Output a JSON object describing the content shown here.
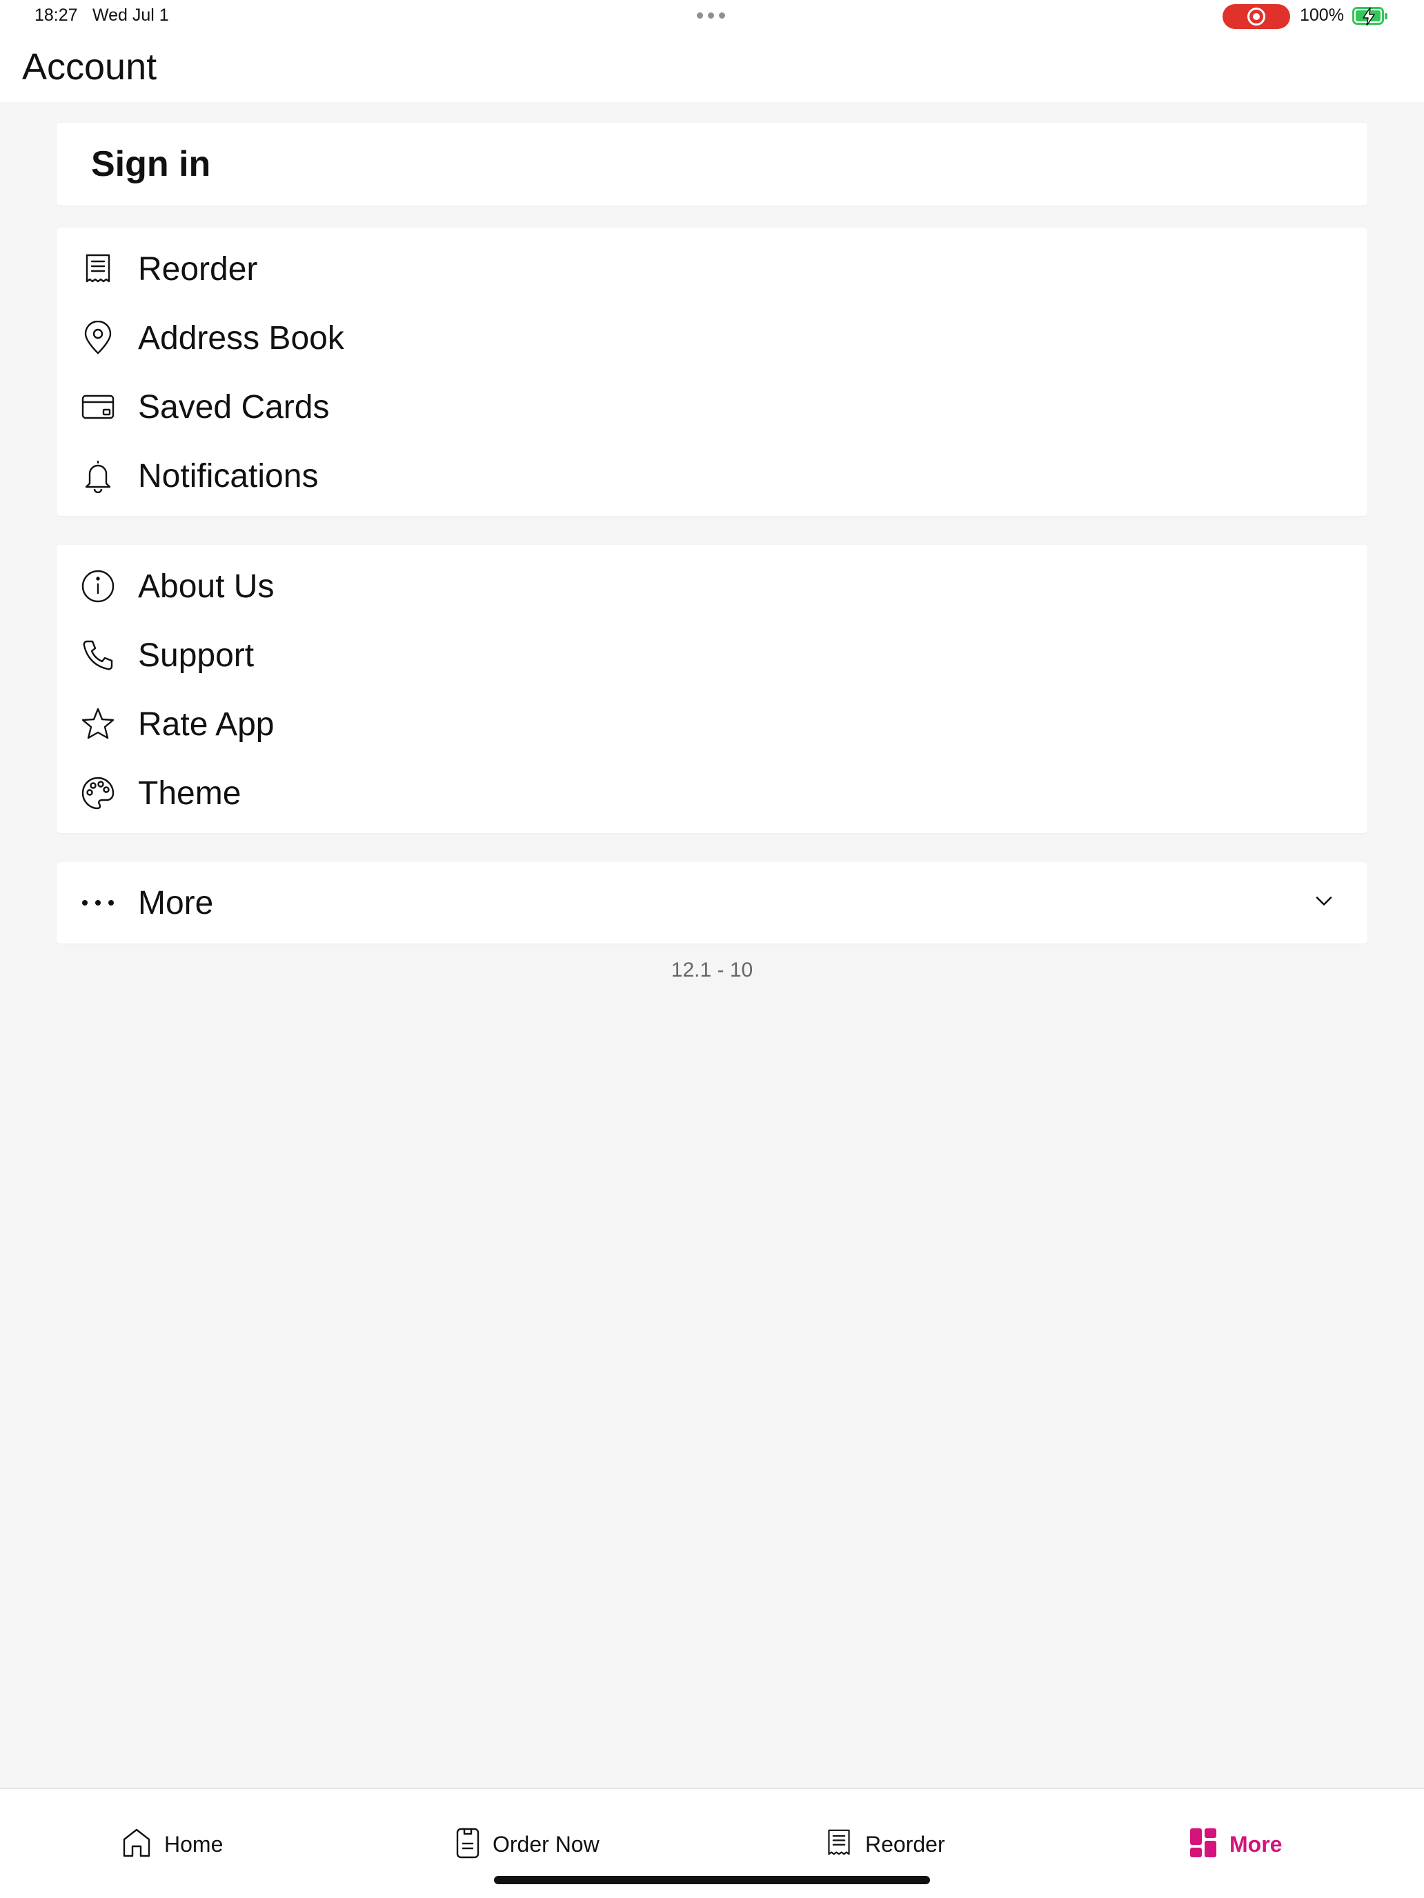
{
  "status_bar": {
    "time": "18:27",
    "date": "Wed Jul 1",
    "battery_percent": "100%",
    "recording": true,
    "charging": true
  },
  "header": {
    "title": "Account"
  },
  "sign_in": {
    "label": "Sign in"
  },
  "account_menu": [
    {
      "label": "Reorder",
      "icon": "receipt-icon"
    },
    {
      "label": "Address Book",
      "icon": "location-pin-icon"
    },
    {
      "label": "Saved Cards",
      "icon": "credit-card-icon"
    },
    {
      "label": "Notifications",
      "icon": "bell-icon"
    }
  ],
  "info_menu": [
    {
      "label": "About Us",
      "icon": "info-icon"
    },
    {
      "label": "Support",
      "icon": "phone-icon"
    },
    {
      "label": "Rate App",
      "icon": "star-icon"
    },
    {
      "label": "Theme",
      "icon": "palette-icon"
    }
  ],
  "more_section": {
    "label": "More",
    "icon": "ellipsis-icon",
    "expanded": false
  },
  "version": "12.1 - 10",
  "tab_bar": {
    "active": "More",
    "accent_color": "#d4137b",
    "tabs": [
      {
        "label": "Home",
        "icon": "home-icon"
      },
      {
        "label": "Order Now",
        "icon": "menu-book-icon"
      },
      {
        "label": "Reorder",
        "icon": "receipt-icon"
      },
      {
        "label": "More",
        "icon": "grid-icon"
      }
    ]
  }
}
